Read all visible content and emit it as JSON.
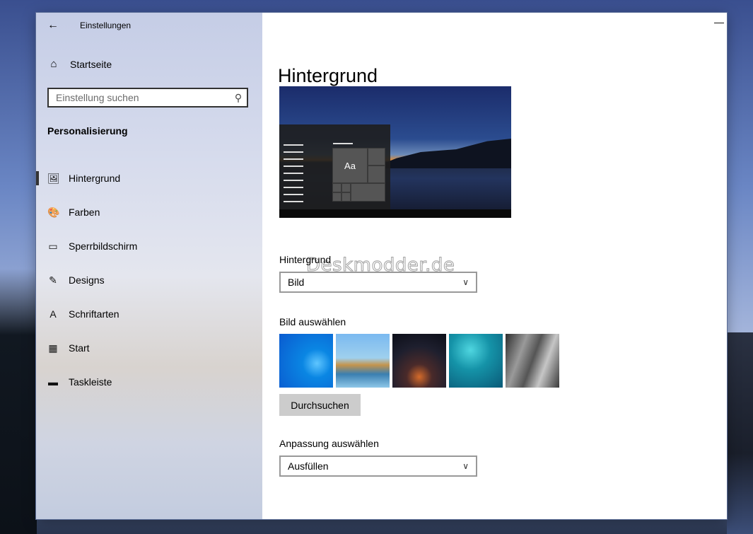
{
  "window": {
    "title": "Einstellungen",
    "back_icon": "←",
    "minimize_icon": "—"
  },
  "sidebar": {
    "home_label": "Startseite",
    "home_icon": "⌂",
    "search_placeholder": "Einstellung suchen",
    "search_icon": "⚲",
    "section_title": "Personalisierung",
    "items": [
      {
        "label": "Hintergrund",
        "icon": "🖼",
        "active": true
      },
      {
        "label": "Farben",
        "icon": "🎨",
        "active": false
      },
      {
        "label": "Sperrbildschirm",
        "icon": "▭",
        "active": false
      },
      {
        "label": "Designs",
        "icon": "✎",
        "active": false
      },
      {
        "label": "Schriftarten",
        "icon": "A",
        "active": false
      },
      {
        "label": "Start",
        "icon": "▦",
        "active": false
      },
      {
        "label": "Taskleiste",
        "icon": "▬",
        "active": false
      }
    ]
  },
  "main": {
    "page_title": "Hintergrund",
    "preview_tile_text": "Aa",
    "watermark": "Deskmodder.de",
    "background_label": "Hintergrund",
    "background_value": "Bild",
    "choose_picture_label": "Bild auswählen",
    "browse_label": "Durchsuchen",
    "fit_label": "Anpassung auswählen",
    "fit_value": "Ausfüllen",
    "chevron_icon": "∨"
  }
}
